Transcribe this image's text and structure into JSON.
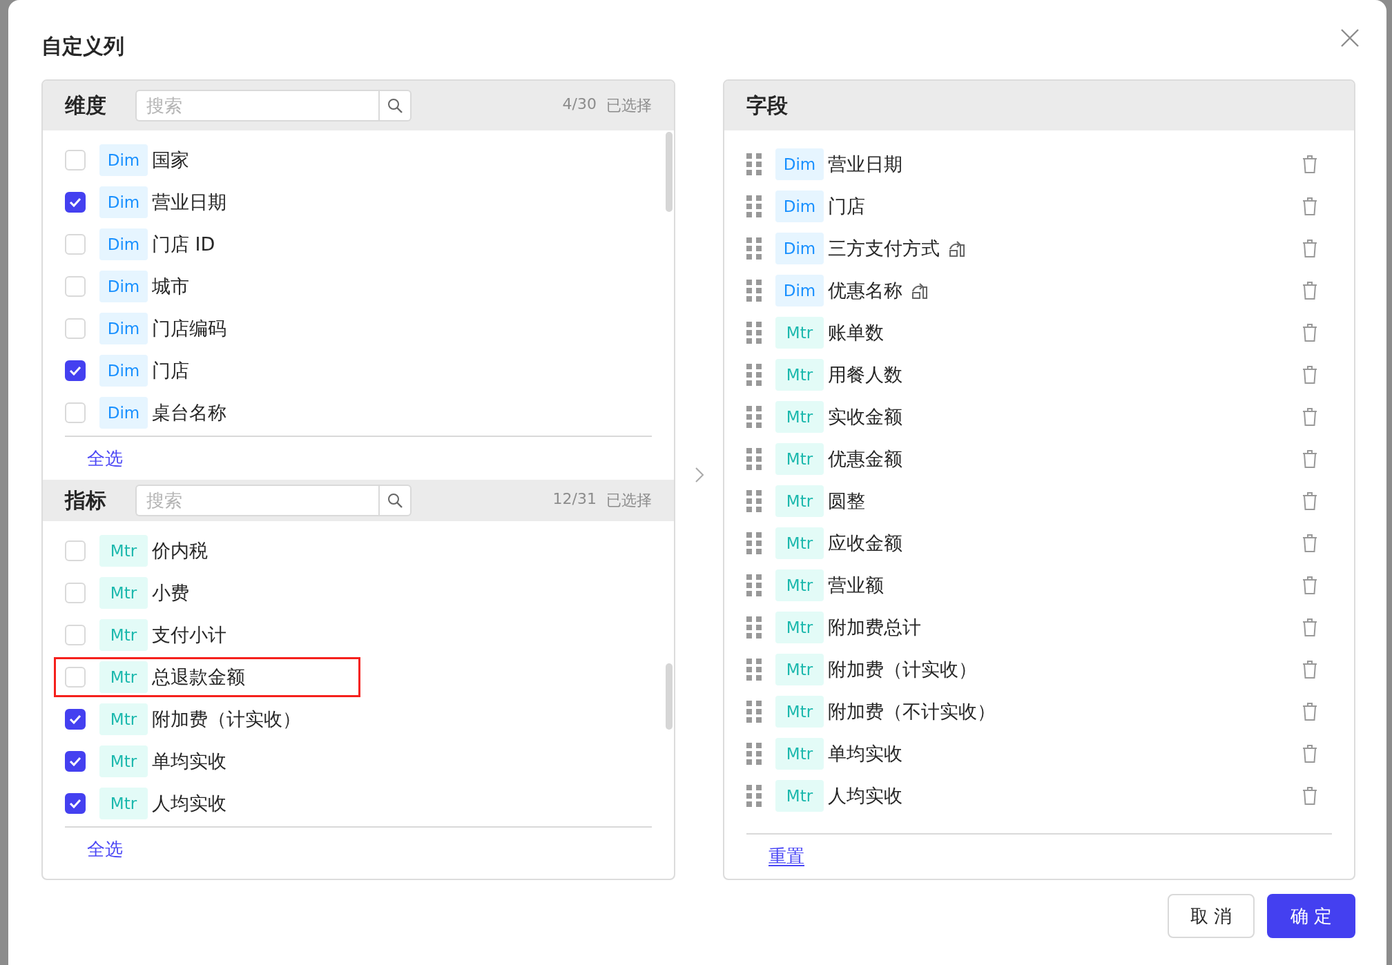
{
  "dialog": {
    "title": "自定义列"
  },
  "dimensions": {
    "title": "维度",
    "search": {
      "placeholder": "搜索"
    },
    "count": "4/30",
    "count_label": "已选择",
    "select_all": "全选",
    "items": [
      {
        "kind": "dim",
        "tag": "Dim",
        "label": "国家",
        "checked": false,
        "highlighted": false
      },
      {
        "kind": "dim",
        "tag": "Dim",
        "label": "营业日期",
        "checked": true,
        "highlighted": false
      },
      {
        "kind": "dim",
        "tag": "Dim",
        "label": "门店 ID",
        "checked": false,
        "highlighted": false
      },
      {
        "kind": "dim",
        "tag": "Dim",
        "label": "城市",
        "checked": false,
        "highlighted": false
      },
      {
        "kind": "dim",
        "tag": "Dim",
        "label": "门店编码",
        "checked": false,
        "highlighted": false
      },
      {
        "kind": "dim",
        "tag": "Dim",
        "label": "门店",
        "checked": true,
        "highlighted": false
      },
      {
        "kind": "dim",
        "tag": "Dim",
        "label": "桌台名称",
        "checked": false,
        "highlighted": false
      }
    ]
  },
  "metrics": {
    "title": "指标",
    "search": {
      "placeholder": "搜索"
    },
    "count": "12/31",
    "count_label": "已选择",
    "select_all": "全选",
    "items": [
      {
        "kind": "mtr",
        "tag": "Mtr",
        "label": "价内税",
        "checked": false,
        "highlighted": false
      },
      {
        "kind": "mtr",
        "tag": "Mtr",
        "label": "小费",
        "checked": false,
        "highlighted": false
      },
      {
        "kind": "mtr",
        "tag": "Mtr",
        "label": "支付小计",
        "checked": false,
        "highlighted": false
      },
      {
        "kind": "mtr",
        "tag": "Mtr",
        "label": "总退款金额",
        "checked": false,
        "highlighted": true
      },
      {
        "kind": "mtr",
        "tag": "Mtr",
        "label": "附加费（计实收）",
        "checked": true,
        "highlighted": false
      },
      {
        "kind": "mtr",
        "tag": "Mtr",
        "label": "单均实收",
        "checked": true,
        "highlighted": false
      },
      {
        "kind": "mtr",
        "tag": "Mtr",
        "label": "人均实收",
        "checked": true,
        "highlighted": false
      }
    ]
  },
  "fields": {
    "title": "字段",
    "reset": "重置",
    "items": [
      {
        "kind": "dim",
        "tag": "Dim",
        "label": "营业日期",
        "marker": false
      },
      {
        "kind": "dim",
        "tag": "Dim",
        "label": "门店",
        "marker": false
      },
      {
        "kind": "dim",
        "tag": "Dim",
        "label": "三方支付方式",
        "marker": true
      },
      {
        "kind": "dim",
        "tag": "Dim",
        "label": "优惠名称",
        "marker": true
      },
      {
        "kind": "mtr",
        "tag": "Mtr",
        "label": "账单数",
        "marker": false
      },
      {
        "kind": "mtr",
        "tag": "Mtr",
        "label": "用餐人数",
        "marker": false
      },
      {
        "kind": "mtr",
        "tag": "Mtr",
        "label": "实收金额",
        "marker": false
      },
      {
        "kind": "mtr",
        "tag": "Mtr",
        "label": "优惠金额",
        "marker": false
      },
      {
        "kind": "mtr",
        "tag": "Mtr",
        "label": "圆整",
        "marker": false
      },
      {
        "kind": "mtr",
        "tag": "Mtr",
        "label": "应收金额",
        "marker": false
      },
      {
        "kind": "mtr",
        "tag": "Mtr",
        "label": "营业额",
        "marker": false
      },
      {
        "kind": "mtr",
        "tag": "Mtr",
        "label": "附加费总计",
        "marker": false
      },
      {
        "kind": "mtr",
        "tag": "Mtr",
        "label": "附加费（计实收）",
        "marker": false
      },
      {
        "kind": "mtr",
        "tag": "Mtr",
        "label": "附加费（不计实收）",
        "marker": false
      },
      {
        "kind": "mtr",
        "tag": "Mtr",
        "label": "单均实收",
        "marker": false
      },
      {
        "kind": "mtr",
        "tag": "Mtr",
        "label": "人均实收",
        "marker": false
      }
    ]
  },
  "buttons": [
    {
      "kind": "secondary",
      "label": "取 消"
    },
    {
      "kind": "primary",
      "label": "确 定"
    }
  ]
}
